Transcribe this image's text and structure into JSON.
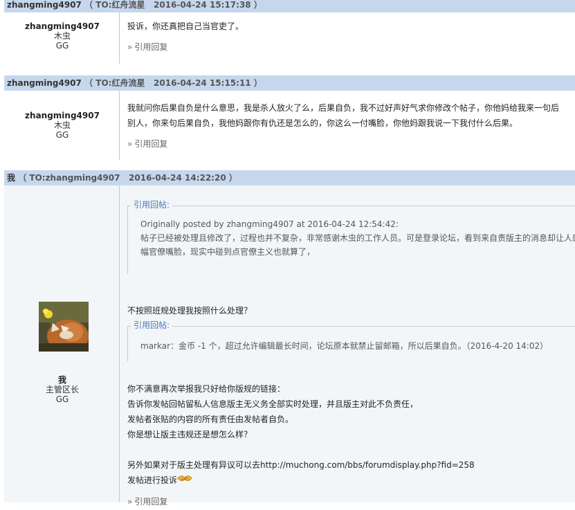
{
  "posts": [
    {
      "author": "zhangming4907",
      "to": "TO:红舟流星",
      "time": "2016-04-24 15:17:38",
      "user_name": "zhangming4907",
      "role": "木虫",
      "gender": "GG",
      "lines": [
        "投诉，你还真把自己当官吏了。"
      ],
      "reply_label": "引用回复"
    },
    {
      "author": "zhangming4907",
      "to": "TO:红舟流星",
      "time": "2016-04-24 15:15:11",
      "user_name": "zhangming4907",
      "role": "木虫",
      "gender": "GG",
      "lines": [
        "我就问你后果自负是什么意思，我是杀人放火了么，后果自负，我不过好声好气求你修改个帖子，你他妈给我来一句后",
        "别人，你来句后果自负，我他妈跟你有仇还是怎么的，你这么一付嘴脸，你他妈跟我说一下我付什么后果。"
      ],
      "reply_label": "引用回复"
    },
    {
      "author": "我",
      "to": "TO:zhangming4907",
      "time": "2016-04-24 14:22:20",
      "user_name": "我",
      "role": "主管区长",
      "gender": "GG",
      "quote1": {
        "legend": "引用回帖:",
        "line1": "Originally posted by zhangming4907 at 2016-04-24 12:54:42:",
        "line2": "帖子已经被处理且修改了，过程也并不复杂，非常感谢木虫的工作人员。可是登录论坛，看到来自责版主的消息却让人感",
        "line3": "幅官僚嘴脸，现实中碰到点官僚主义也就算了，"
      },
      "question": "不按照班规处理我按照什么处理？",
      "quote2": {
        "legend": "引用回帖:",
        "line1": "markar：金币 -1 个，超过允许编辑最长时间，论坛原本就禁止留邮箱，所以后果自负。（2016-4-20 14:02）"
      },
      "body_lines": [
        "你不满意再次举报我只好给你版规的链接：",
        "告诉你发帖回帖留私人信息版主无义务全部实时处理，并且版主对此不负责任，",
        "发帖者张贴的内容的所有责任由发帖者自负。",
        "你是想让版主违规还是想怎么样？"
      ],
      "extra_line": "另外如果对于版主处理有异议可以去http://muchong.com/bbs/forumdisplay.php?fid=258",
      "last_line": "发帖进行投诉",
      "reply_label": "引用回复"
    }
  ],
  "icons": {
    "reply_arrow": "»",
    "avatar": "fox-with-flower-avatar",
    "emoticon": "handshake-emoticon"
  },
  "colors": {
    "header_bg": "#c6d7ed",
    "quote_legend": "#4a77b4",
    "mod_post_bg": "#f3f6f9"
  }
}
